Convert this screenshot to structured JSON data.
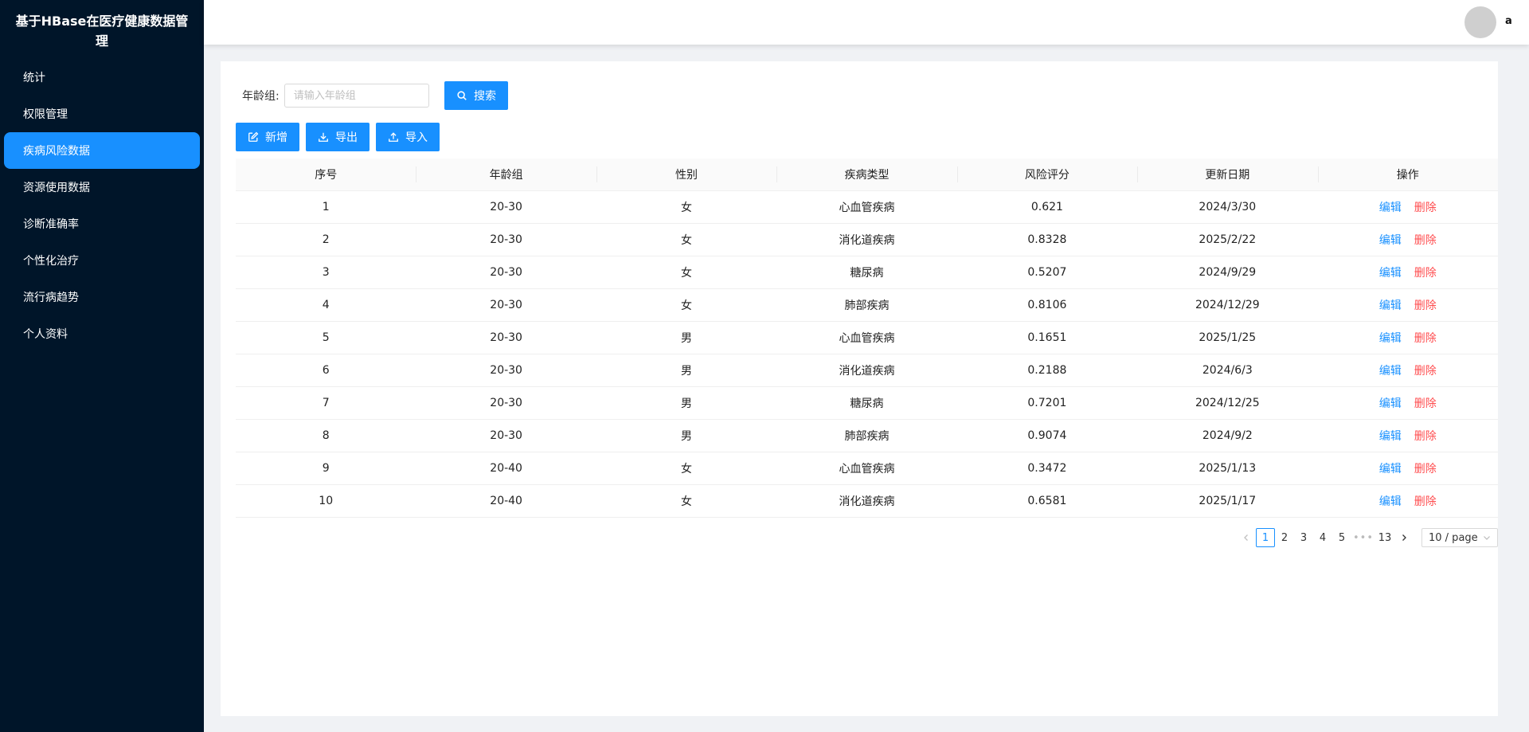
{
  "app": {
    "title": "基于HBase在医疗健康数据管理",
    "user_name": "a"
  },
  "sidebar": {
    "items": [
      {
        "label": "统计"
      },
      {
        "label": "权限管理"
      },
      {
        "label": "疾病风险数据"
      },
      {
        "label": "资源使用数据"
      },
      {
        "label": "诊断准确率"
      },
      {
        "label": "个性化治疗"
      },
      {
        "label": "流行病趋势"
      },
      {
        "label": "个人资料"
      }
    ],
    "active_index": 2
  },
  "search": {
    "label": "年龄组:",
    "placeholder": "请输入年龄组",
    "value": "",
    "button_label": "搜索"
  },
  "toolbar": {
    "add_label": "新增",
    "export_label": "导出",
    "import_label": "导入"
  },
  "table": {
    "columns": [
      "序号",
      "年龄组",
      "性别",
      "疾病类型",
      "风险评分",
      "更新日期",
      "操作"
    ],
    "edit_label": "编辑",
    "delete_label": "删除",
    "rows": [
      [
        "1",
        "20-30",
        "女",
        "心血管疾病",
        "0.621",
        "2024/3/30"
      ],
      [
        "2",
        "20-30",
        "女",
        "消化道疾病",
        "0.8328",
        "2025/2/22"
      ],
      [
        "3",
        "20-30",
        "女",
        "糖尿病",
        "0.5207",
        "2024/9/29"
      ],
      [
        "4",
        "20-30",
        "女",
        "肺部疾病",
        "0.8106",
        "2024/12/29"
      ],
      [
        "5",
        "20-30",
        "男",
        "心血管疾病",
        "0.1651",
        "2025/1/25"
      ],
      [
        "6",
        "20-30",
        "男",
        "消化道疾病",
        "0.2188",
        "2024/6/3"
      ],
      [
        "7",
        "20-30",
        "男",
        "糖尿病",
        "0.7201",
        "2024/12/25"
      ],
      [
        "8",
        "20-30",
        "男",
        "肺部疾病",
        "0.9074",
        "2024/9/2"
      ],
      [
        "9",
        "20-40",
        "女",
        "心血管疾病",
        "0.3472",
        "2025/1/13"
      ],
      [
        "10",
        "20-40",
        "女",
        "消化道疾病",
        "0.6581",
        "2025/1/17"
      ]
    ]
  },
  "pagination": {
    "pages": [
      "1",
      "2",
      "3",
      "4",
      "5"
    ],
    "current": "1",
    "ellipsis": "•••",
    "last": "13",
    "page_size": "10 / page"
  },
  "colors": {
    "sidebar_bg": "#001529",
    "primary": "#1890ff",
    "danger": "#ff4d4f"
  }
}
